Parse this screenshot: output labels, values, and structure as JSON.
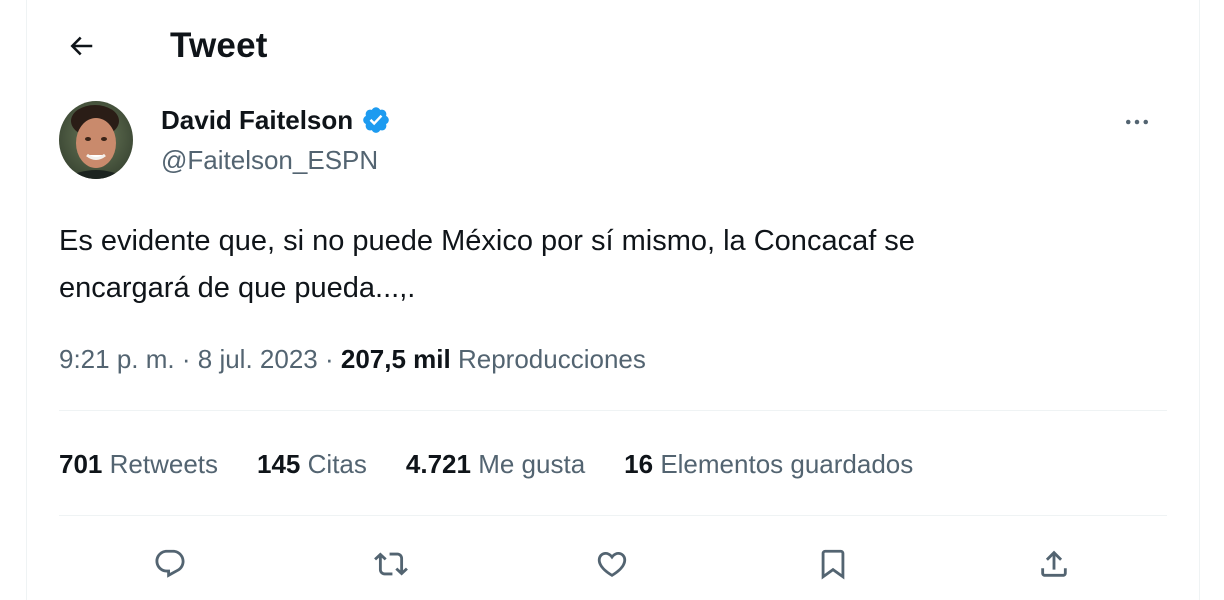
{
  "header": {
    "title": "Tweet",
    "back_icon": "arrow-left-icon"
  },
  "author": {
    "name": "David Faitelson",
    "handle": "@Faitelson_ESPN",
    "verified": true,
    "verified_color": "#1d9bf0"
  },
  "tweet": {
    "text_line_1": "Es evidente que, si no puede México por sí mismo, la Concacaf se",
    "text_line_2": "encargará de que pueda...,.",
    "time": "9:21 p. m.",
    "separator": "·",
    "date": "8 jul. 2023",
    "views_count": "207,5 mil",
    "views_label": "Reproducciones"
  },
  "stats": [
    {
      "count": "701",
      "label": "Retweets"
    },
    {
      "count": "145",
      "label": "Citas"
    },
    {
      "count": "4.721",
      "label": "Me gusta"
    },
    {
      "count": "16",
      "label": "Elementos guardados"
    }
  ],
  "actions": [
    "reply-icon",
    "retweet-icon",
    "like-icon",
    "bookmark-icon",
    "share-icon"
  ],
  "colors": {
    "text": "#0f1419",
    "secondary": "#536471",
    "divider": "#eff3f4",
    "accent": "#1d9bf0"
  }
}
